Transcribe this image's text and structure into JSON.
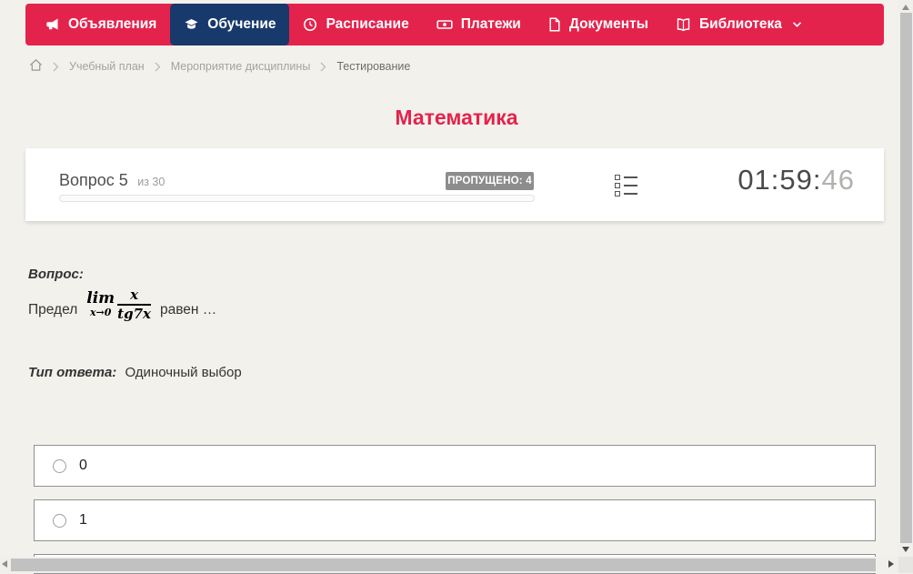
{
  "colors": {
    "accent_red": "#e4234c",
    "active_navy": "#18396b",
    "page_bg": "#f2f1ec",
    "badge_gray": "#8d8d8d"
  },
  "nav": {
    "items": [
      {
        "label": "Объявления",
        "icon": "megaphone-icon",
        "active": false
      },
      {
        "label": "Обучение",
        "icon": "graduation-cap-icon",
        "active": true
      },
      {
        "label": "Расписание",
        "icon": "clock-icon",
        "active": false
      },
      {
        "label": "Платежи",
        "icon": "banknote-icon",
        "active": false
      },
      {
        "label": "Документы",
        "icon": "document-icon",
        "active": false
      },
      {
        "label": "Библиотека",
        "icon": "book-icon",
        "active": false,
        "has_dropdown": true
      }
    ]
  },
  "breadcrumb": {
    "items": [
      "Учебный план",
      "Мероприятие дисциплины",
      "Тестирование"
    ]
  },
  "page_title": "Математика",
  "quiz_header": {
    "question_label": "Вопрос 5",
    "question_total": "из 30",
    "skipped_badge": "ПРОПУЩЕНО: 4",
    "timer_main": "01:59:",
    "timer_seconds": "46"
  },
  "question": {
    "label": "Вопрос:",
    "text_before": "Предел",
    "formula": {
      "operator": "lim",
      "subscript": "x→0",
      "numerator": "x",
      "denominator": "tg7x"
    },
    "text_after": "равен …",
    "answer_type_label": "Тип ответа:",
    "answer_type_value": "Одиночный выбор"
  },
  "options": [
    {
      "label": "0"
    },
    {
      "label": "1"
    },
    {
      "label": ""
    }
  ]
}
